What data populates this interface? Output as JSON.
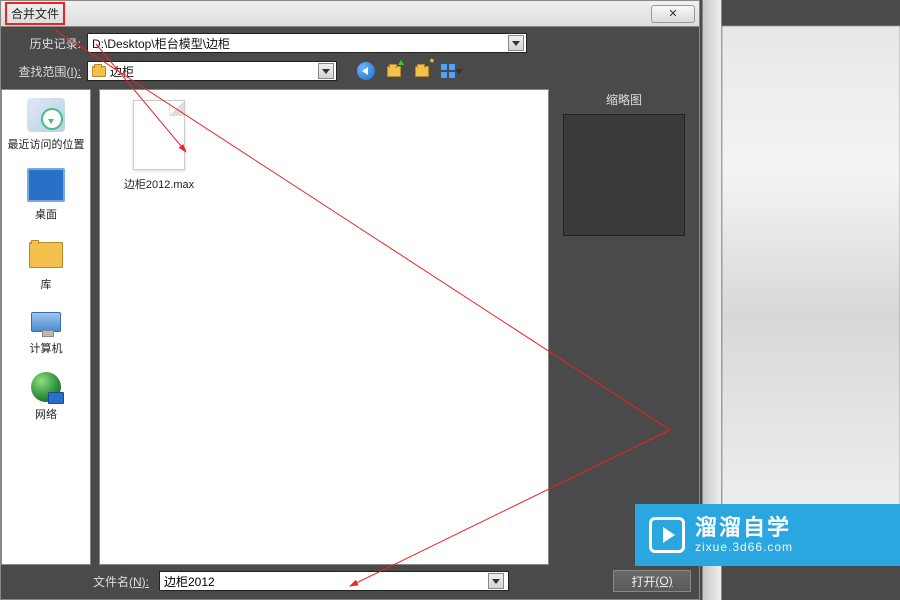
{
  "dialog": {
    "title": "合并文件",
    "close_glyph": "✕"
  },
  "history": {
    "label": "历史记录:",
    "value": "D:\\Desktop\\柜台模型\\边柜"
  },
  "scope": {
    "label": "查找范围",
    "access": "(I):",
    "value": "边柜"
  },
  "toolbar": {
    "back": "back",
    "folder_up": "folder-up",
    "folder_new": "folder-new",
    "view": "view-mode"
  },
  "sidebar": {
    "items": [
      {
        "id": "recent",
        "label": "最近访问的位置"
      },
      {
        "id": "desktop",
        "label": "桌面"
      },
      {
        "id": "library",
        "label": "库"
      },
      {
        "id": "computer",
        "label": "计算机"
      },
      {
        "id": "network",
        "label": "网络"
      }
    ]
  },
  "files": [
    {
      "name": "边柜2012.max"
    }
  ],
  "preview": {
    "label": "缩略图"
  },
  "footer": {
    "label_prefix": "文件名",
    "label_access": "(N):",
    "filename": "边柜2012",
    "open": "打开",
    "open_access": "(O)"
  },
  "watermark": {
    "cn": "溜溜自学",
    "url": "zixue.3d66.com"
  }
}
